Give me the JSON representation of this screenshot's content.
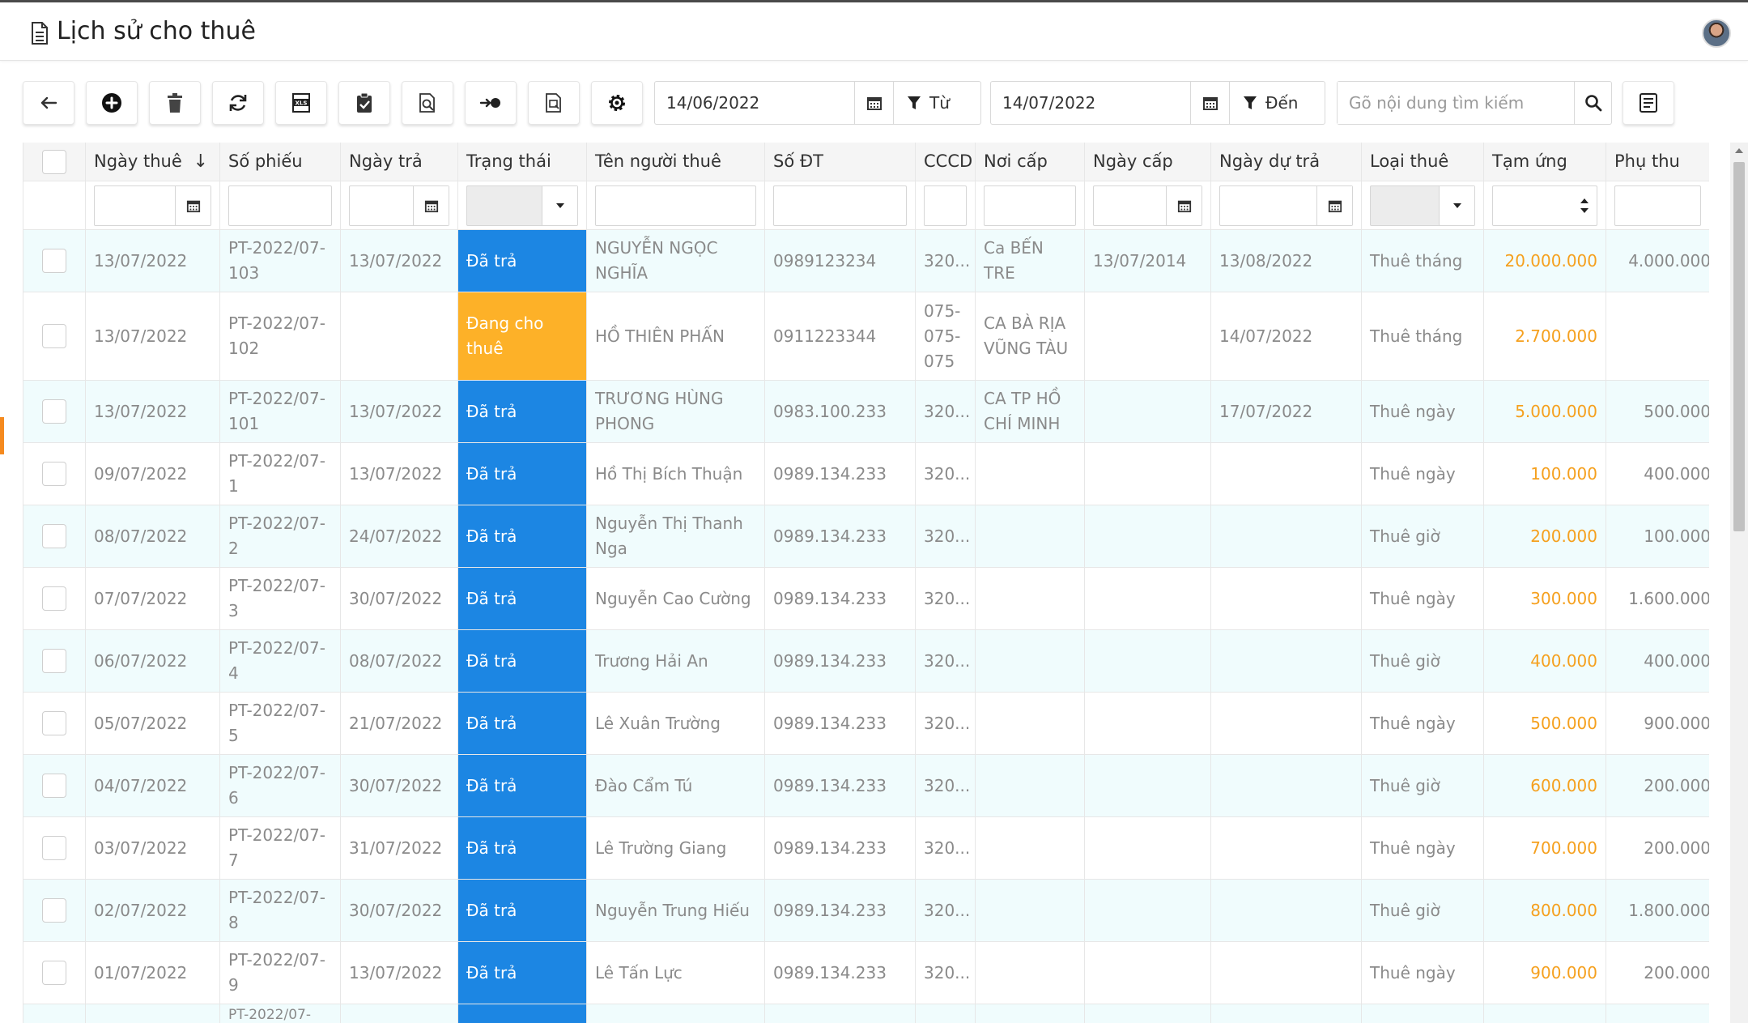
{
  "header": {
    "title": "Lịch sử cho thuê"
  },
  "toolbar": {
    "buttons": [
      {
        "name": "back-button",
        "icon": "arrow-left-icon"
      },
      {
        "name": "add-button",
        "icon": "plus-circle-icon"
      },
      {
        "name": "delete-button",
        "icon": "trash-icon"
      },
      {
        "name": "refresh-button",
        "icon": "refresh-icon"
      },
      {
        "name": "export-excel-button",
        "icon": "excel-file-icon"
      },
      {
        "name": "approve-button",
        "icon": "clipboard-check-icon"
      },
      {
        "name": "preview-button",
        "icon": "file-search-icon"
      },
      {
        "name": "move-button",
        "icon": "arrow-to-dot-icon"
      },
      {
        "name": "view-detail-button",
        "icon": "document-view-icon"
      },
      {
        "name": "settings-button",
        "icon": "gear-icon"
      }
    ],
    "from_date": "14/06/2022",
    "from_label": "Từ",
    "to_date": "14/07/2022",
    "to_label": "Đến",
    "search_placeholder": "Gõ nội dung tìm kiếm",
    "report_button": "report-icon"
  },
  "colors": {
    "status_returned": "#1c86e3",
    "status_renting": "#fdb128",
    "amount": "#f5a01e",
    "row_alt": "#f0fcfd"
  },
  "table": {
    "columns": [
      "Ngày thuê",
      "Số phiếu",
      "Ngày trả",
      "Trạng thái",
      "Tên người thuê",
      "Số ĐT",
      "CCCD",
      "Nơi cấp",
      "Ngày cấp",
      "Ngày dự trả",
      "Loại thuê",
      "Tạm ứng",
      "Phụ thu"
    ],
    "sort_indicator": "↓",
    "rows": [
      {
        "ngay_thue": "13/07/2022",
        "so_phieu": "PT-2022/07-103",
        "ngay_tra": "13/07/2022",
        "trang_thai": "Đã trả",
        "ten": "NGUYỄN NGỌC NGHĨA",
        "sdt": "0989123234",
        "cccd": "320...",
        "noi_cap": "Ca BẾN TRE",
        "ngay_cap": "13/07/2014",
        "ngay_du_tra": "13/08/2022",
        "loai": "Thuê tháng",
        "tam_ung": "20.000.000",
        "phu_thu": "4.000.000"
      },
      {
        "ngay_thue": "13/07/2022",
        "so_phieu": "PT-2022/07-102",
        "ngay_tra": "",
        "trang_thai": "Đang cho thuê",
        "ten": "HỒ THIÊN PHẤN",
        "sdt": "0911223344",
        "cccd": "075-075-075",
        "noi_cap": "CA BÀ RỊA VŨNG TÀU",
        "ngay_cap": "",
        "ngay_du_tra": "14/07/2022",
        "loai": "Thuê tháng",
        "tam_ung": "2.700.000",
        "phu_thu": ""
      },
      {
        "ngay_thue": "13/07/2022",
        "so_phieu": "PT-2022/07-101",
        "ngay_tra": "13/07/2022",
        "trang_thai": "Đã trả",
        "ten": "TRƯƠNG HÙNG PHONG",
        "sdt": "0983.100.233",
        "cccd": "320...",
        "noi_cap": "CA TP HỒ CHÍ MINH",
        "ngay_cap": "",
        "ngay_du_tra": "17/07/2022",
        "loai": "Thuê ngày",
        "tam_ung": "5.000.000",
        "phu_thu": "500.000"
      },
      {
        "ngay_thue": "09/07/2022",
        "so_phieu": "PT-2022/07-1",
        "ngay_tra": "13/07/2022",
        "trang_thai": "Đã trả",
        "ten": "Hồ Thị Bích Thuận",
        "sdt": "0989.134.233",
        "cccd": "320...",
        "noi_cap": "",
        "ngay_cap": "",
        "ngay_du_tra": "",
        "loai": "Thuê ngày",
        "tam_ung": "100.000",
        "phu_thu": "400.000"
      },
      {
        "ngay_thue": "08/07/2022",
        "so_phieu": "PT-2022/07-2",
        "ngay_tra": "24/07/2022",
        "trang_thai": "Đã trả",
        "ten": "Nguyễn Thị Thanh Nga",
        "sdt": "0989.134.233",
        "cccd": "320...",
        "noi_cap": "",
        "ngay_cap": "",
        "ngay_du_tra": "",
        "loai": "Thuê giờ",
        "tam_ung": "200.000",
        "phu_thu": "100.000"
      },
      {
        "ngay_thue": "07/07/2022",
        "so_phieu": "PT-2022/07-3",
        "ngay_tra": "30/07/2022",
        "trang_thai": "Đã trả",
        "ten": "Nguyễn Cao Cường",
        "sdt": "0989.134.233",
        "cccd": "320...",
        "noi_cap": "",
        "ngay_cap": "",
        "ngay_du_tra": "",
        "loai": "Thuê ngày",
        "tam_ung": "300.000",
        "phu_thu": "1.600.000"
      },
      {
        "ngay_thue": "06/07/2022",
        "so_phieu": "PT-2022/07-4",
        "ngay_tra": "08/07/2022",
        "trang_thai": "Đã trả",
        "ten": "Trương Hải An",
        "sdt": "0989.134.233",
        "cccd": "320...",
        "noi_cap": "",
        "ngay_cap": "",
        "ngay_du_tra": "",
        "loai": "Thuê giờ",
        "tam_ung": "400.000",
        "phu_thu": "400.000"
      },
      {
        "ngay_thue": "05/07/2022",
        "so_phieu": "PT-2022/07-5",
        "ngay_tra": "21/07/2022",
        "trang_thai": "Đã trả",
        "ten": "Lê Xuân Trường",
        "sdt": "0989.134.233",
        "cccd": "320...",
        "noi_cap": "",
        "ngay_cap": "",
        "ngay_du_tra": "",
        "loai": "Thuê ngày",
        "tam_ung": "500.000",
        "phu_thu": "900.000"
      },
      {
        "ngay_thue": "04/07/2022",
        "so_phieu": "PT-2022/07-6",
        "ngay_tra": "30/07/2022",
        "trang_thai": "Đã trả",
        "ten": "Đào Cẩm Tú",
        "sdt": "0989.134.233",
        "cccd": "320...",
        "noi_cap": "",
        "ngay_cap": "",
        "ngay_du_tra": "",
        "loai": "Thuê giờ",
        "tam_ung": "600.000",
        "phu_thu": "200.000"
      },
      {
        "ngay_thue": "03/07/2022",
        "so_phieu": "PT-2022/07-7",
        "ngay_tra": "31/07/2022",
        "trang_thai": "Đã trả",
        "ten": "Lê Trường Giang",
        "sdt": "0989.134.233",
        "cccd": "320...",
        "noi_cap": "",
        "ngay_cap": "",
        "ngay_du_tra": "",
        "loai": "Thuê ngày",
        "tam_ung": "700.000",
        "phu_thu": "200.000"
      },
      {
        "ngay_thue": "02/07/2022",
        "so_phieu": "PT-2022/07-8",
        "ngay_tra": "30/07/2022",
        "trang_thai": "Đã trả",
        "ten": "Nguyễn Trung Hiếu",
        "sdt": "0989.134.233",
        "cccd": "320...",
        "noi_cap": "",
        "ngay_cap": "",
        "ngay_du_tra": "",
        "loai": "Thuê giờ",
        "tam_ung": "800.000",
        "phu_thu": "1.800.000"
      },
      {
        "ngay_thue": "01/07/2022",
        "so_phieu": "PT-2022/07-9",
        "ngay_tra": "13/07/2022",
        "trang_thai": "Đã trả",
        "ten": "Lê Tấn Lực",
        "sdt": "0989.134.233",
        "cccd": "320...",
        "noi_cap": "",
        "ngay_cap": "",
        "ngay_du_tra": "",
        "loai": "Thuê ngày",
        "tam_ung": "900.000",
        "phu_thu": "200.000"
      },
      {
        "ngay_thue": "",
        "so_phieu": "PT-2022/07-",
        "ngay_tra": "",
        "trang_thai": "",
        "ten": "",
        "sdt": "",
        "cccd": "",
        "noi_cap": "",
        "ngay_cap": "",
        "ngay_du_tra": "",
        "loai": "",
        "tam_ung": "",
        "phu_thu": ""
      }
    ]
  }
}
